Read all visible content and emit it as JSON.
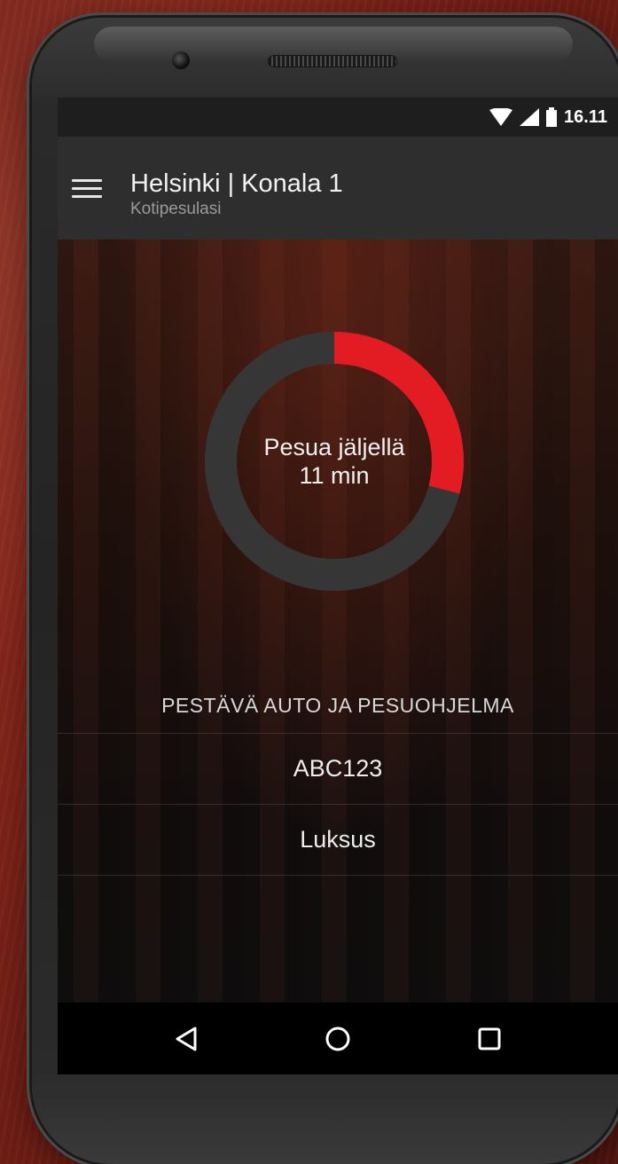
{
  "status_bar": {
    "time": "16.11",
    "icons": [
      "wifi-icon",
      "cell-signal-icon",
      "battery-icon"
    ]
  },
  "app_bar": {
    "title": "Helsinki | Konala 1",
    "subtitle": "Kotipesulasi",
    "menu_icon": "menu-icon"
  },
  "progress": {
    "line1": "Pesua jäljellä",
    "line2": "11 min",
    "fraction_elapsed": 0.29,
    "accent_color": "#e31b23",
    "track_color": "#363636"
  },
  "section": {
    "header": "PESTÄVÄ AUTO JA PESUOHJELMA",
    "items": [
      {
        "label": "ABC123"
      },
      {
        "label": "Luksus"
      }
    ]
  },
  "nav_bar": {
    "buttons": [
      "back-icon",
      "home-icon",
      "recents-icon"
    ]
  }
}
